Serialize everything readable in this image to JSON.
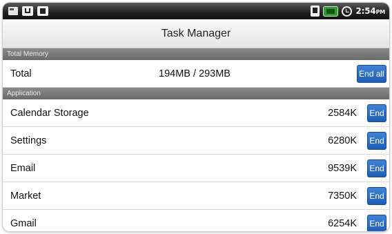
{
  "status_bar": {
    "left_icons": [
      "sd-card-icon",
      "usb-icon",
      "notification-icon"
    ],
    "right_icons": [
      "phone-signal-icon",
      "battery-icon",
      "alarm-icon"
    ],
    "time": "2:54",
    "ampm": "PM"
  },
  "header": {
    "title": "Task Manager"
  },
  "memory_section": {
    "label": "Total Memory",
    "row": {
      "name": "Total",
      "value": "194MB / 293MB",
      "button_label": "End all"
    }
  },
  "application_section": {
    "label": "Application",
    "apps": [
      {
        "name": "Calendar Storage",
        "size": "2584K",
        "button_label": "End"
      },
      {
        "name": "Settings",
        "size": "6280K",
        "button_label": "End"
      },
      {
        "name": "Email",
        "size": "9539K",
        "button_label": "End"
      },
      {
        "name": "Market",
        "size": "7350K",
        "button_label": "End"
      },
      {
        "name": "Gmail",
        "size": "6254K",
        "button_label": "End"
      }
    ]
  },
  "colors": {
    "button": "#2a6cc3",
    "section": "#787878",
    "status_bar": "#1f1f1f",
    "battery": "#2d9b2d"
  }
}
